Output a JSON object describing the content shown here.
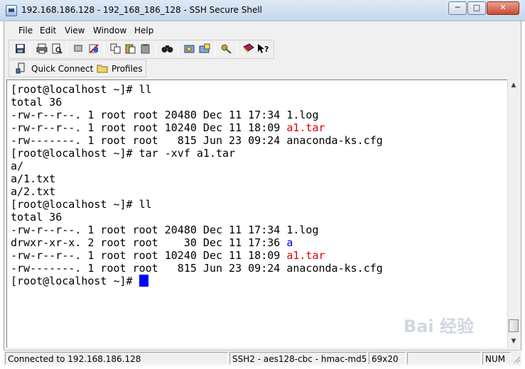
{
  "window": {
    "title": "192.168.186.128 - 192_168_186_128 - SSH Secure Shell",
    "minimize": "─",
    "maximize": "□",
    "close": "✕"
  },
  "menu": [
    {
      "label": "File"
    },
    {
      "label": "Edit"
    },
    {
      "label": "View"
    },
    {
      "label": "Window"
    },
    {
      "label": "Help"
    }
  ],
  "toolbar": {
    "icons": [
      "save-icon",
      "print-icon",
      "print-preview-icon",
      "new-terminal-icon",
      "new-file-transfer-icon",
      "copy-icon",
      "paste-icon",
      "paste-plain-icon",
      "find-icon",
      "settings-icon",
      "profiles-icon",
      "key-icon",
      "help-book-icon",
      "context-help-icon"
    ]
  },
  "quickbar": {
    "quick_connect": "Quick Connect",
    "profiles": "Profiles"
  },
  "terminal": {
    "lines": [
      [
        {
          "t": "[root@localhost ~]# ll"
        }
      ],
      [
        {
          "t": "total 36"
        }
      ],
      [
        {
          "t": "-rw-r--r--. 1 root root 20480 Dec 11 17:34 1.log"
        }
      ],
      [
        {
          "t": "-rw-r--r--. 1 root root 10240 Dec 11 18:09 "
        },
        {
          "t": "a1.tar",
          "c": "red"
        }
      ],
      [
        {
          "t": "-rw-------. 1 root root   815 Jun 23 09:24 anaconda-ks.cfg"
        }
      ],
      [
        {
          "t": "[root@localhost ~]# tar -xvf a1.tar"
        }
      ],
      [
        {
          "t": "a/"
        }
      ],
      [
        {
          "t": "a/1.txt"
        }
      ],
      [
        {
          "t": "a/2.txt"
        }
      ],
      [
        {
          "t": "[root@localhost ~]# ll"
        }
      ],
      [
        {
          "t": "total 36"
        }
      ],
      [
        {
          "t": "-rw-r--r--. 1 root root 20480 Dec 11 17:34 1.log"
        }
      ],
      [
        {
          "t": "drwxr-xr-x. 2 root root    30 Dec 11 17:36 "
        },
        {
          "t": "a",
          "c": "blue"
        }
      ],
      [
        {
          "t": "-rw-r--r--. 1 root root 10240 Dec 11 18:09 "
        },
        {
          "t": "a1.tar",
          "c": "red"
        }
      ],
      [
        {
          "t": "-rw-------. 1 root root   815 Jun 23 09:24 anaconda-ks.cfg"
        }
      ],
      [
        {
          "t": "[root@localhost ~]# "
        },
        {
          "cursor": true
        }
      ]
    ]
  },
  "scrollbar": {
    "up": "▲",
    "down": "▼"
  },
  "status": {
    "connection": "Connected to 192.168.186.128",
    "cipher": "SSH2 - aes128-cbc - hmac-md5",
    "size": "69x20",
    "num": "NUM"
  },
  "watermark": "Bai 经验",
  "colors": {
    "red_text": "#dd0000",
    "blue_text": "#0000dd",
    "cursor": "#0000ff"
  }
}
